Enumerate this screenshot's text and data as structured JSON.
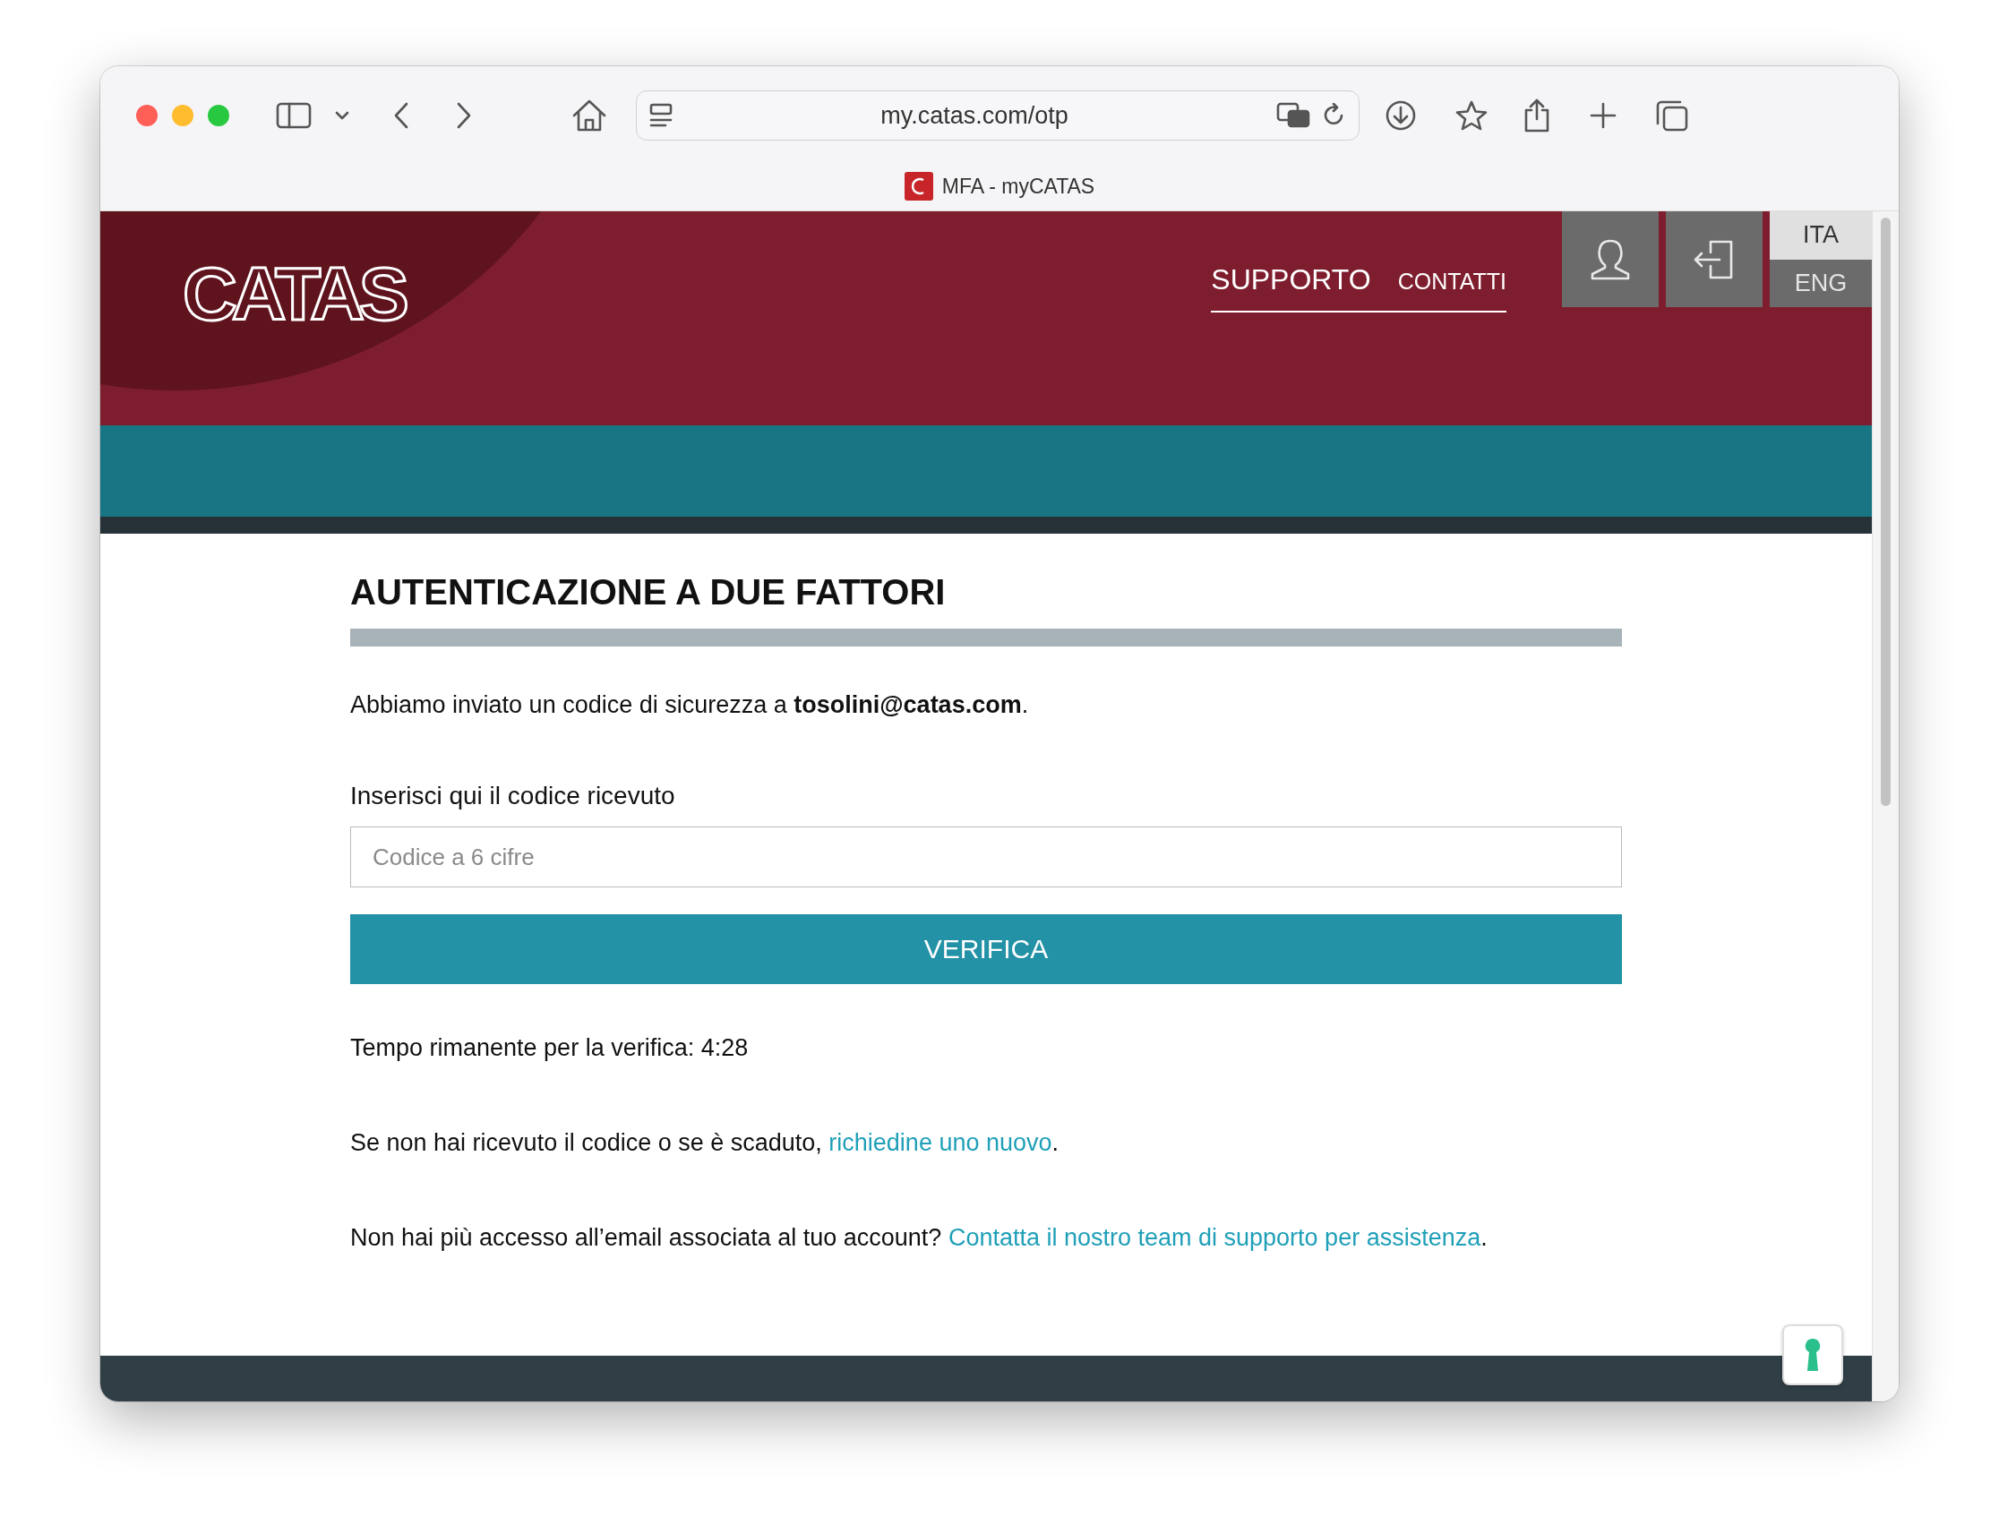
{
  "browser": {
    "url": "my.catas.com/otp",
    "tab_title": "MFA - myCATAS"
  },
  "header": {
    "logo": "CATAS",
    "nav": [
      {
        "label": "SUPPORTO",
        "selected": true
      },
      {
        "label": "CONTATTI",
        "selected": false
      }
    ],
    "languages": [
      {
        "label": "ITA",
        "selected": true
      },
      {
        "label": "ENG",
        "selected": false
      }
    ]
  },
  "content": {
    "title": "AUTENTICAZIONE A DUE FATTORI",
    "intro": "Abbiamo inviato un codice di sicurezza a **tosolini@catas.com**.",
    "code_label": "Inserisci qui il codice ricevuto",
    "code_field": {
      "placeholder": "Codice a 6 cifre"
    },
    "verify_button": "VERIFICA",
    "timer": "Tempo rimanente per la verifica: 4:28",
    "resend": {
      "text": "Se non hai ricevuto il codice o se è scaduto, ",
      "link": "richiedine uno nuovo",
      "end": "."
    },
    "support": {
      "text": "Non hai più accesso all’email associata al tuo account? ",
      "link": "Contatta il nostro team di supporto per assistenza",
      "end": "."
    }
  }
}
